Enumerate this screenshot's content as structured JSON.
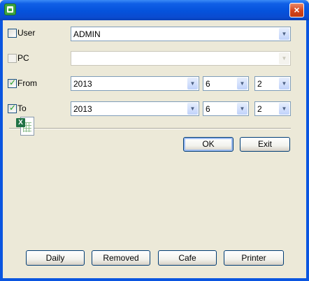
{
  "window": {
    "title": "",
    "close_glyph": "×"
  },
  "filters": {
    "user": {
      "label": "User",
      "checked": false,
      "value": "ADMIN"
    },
    "pc": {
      "label": "PC",
      "checked": false,
      "value": ""
    },
    "from": {
      "label": "From",
      "checked": true,
      "year": "2013",
      "month": "6",
      "day": "2"
    },
    "to": {
      "label": "To",
      "checked": true,
      "year": "2013",
      "month": "6",
      "day": "2"
    }
  },
  "dropdown_arrow": "▼",
  "check_glyph": "✓",
  "excel_glyph": "X",
  "actions": {
    "ok_label": "OK",
    "exit_label": "Exit"
  },
  "reports": {
    "daily_label": "Daily",
    "removed_label": "Removed",
    "cafe_label": "Cafe",
    "printer_label": "Printer"
  },
  "colors": {
    "titlebar": "#0552dc",
    "face": "#ece9d8",
    "check_tick": "#21a121"
  }
}
